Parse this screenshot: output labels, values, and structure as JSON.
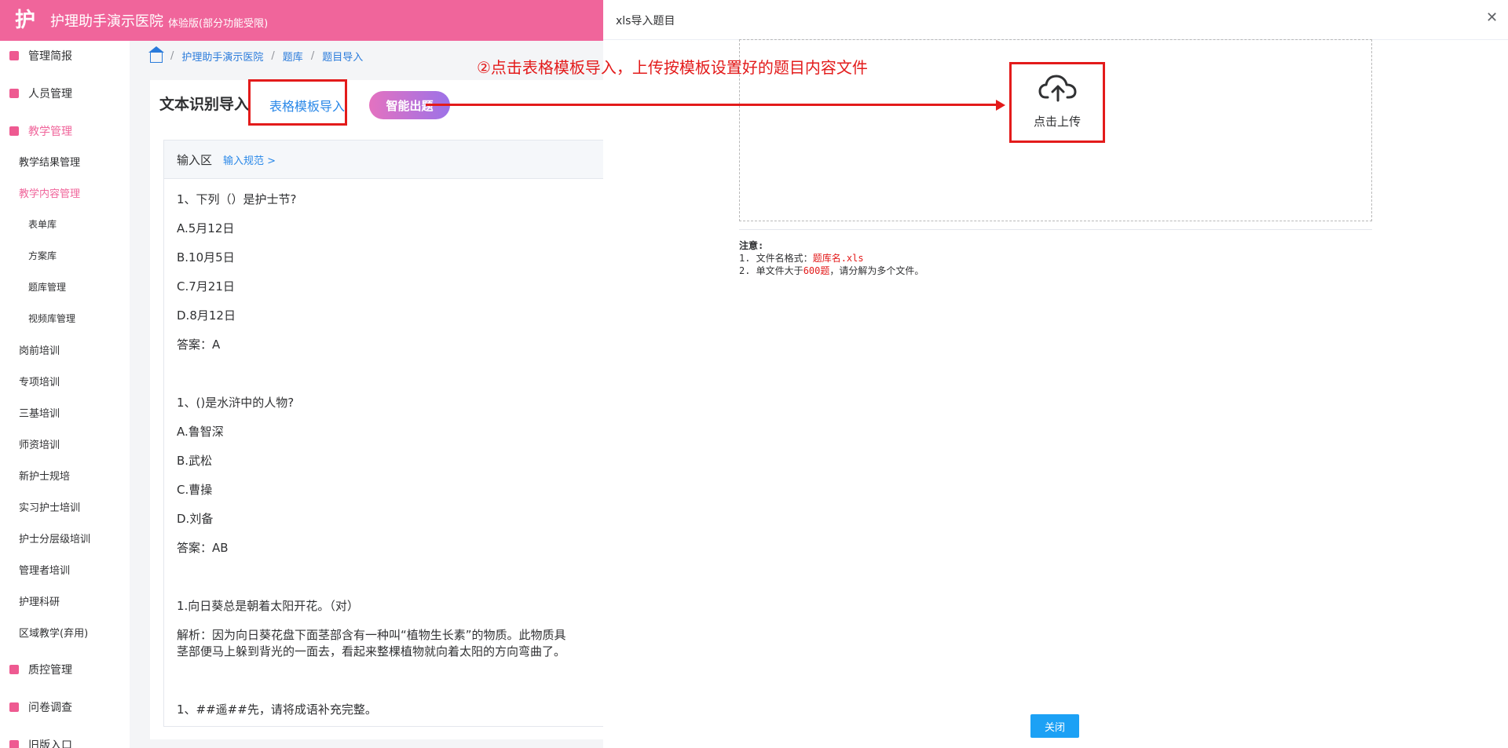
{
  "header": {
    "logo_text": "护",
    "title": "护理助手演示医院",
    "subtitle": "体验版(部分功能受限)"
  },
  "sidebar": {
    "items": [
      {
        "label": "管理简报"
      },
      {
        "label": "人员管理"
      },
      {
        "label": "教学管理"
      },
      {
        "label": "教学结果管理"
      },
      {
        "label": "教学内容管理"
      },
      {
        "label": "表单库"
      },
      {
        "label": "方案库"
      },
      {
        "label": "题库管理"
      },
      {
        "label": "视频库管理"
      },
      {
        "label": "岗前培训"
      },
      {
        "label": "专项培训"
      },
      {
        "label": "三基培训"
      },
      {
        "label": "师资培训"
      },
      {
        "label": "新护士规培"
      },
      {
        "label": "实习护士培训"
      },
      {
        "label": "护士分层级培训"
      },
      {
        "label": "管理者培训"
      },
      {
        "label": "护理科研"
      },
      {
        "label": "区域教学(弃用)"
      },
      {
        "label": "质控管理"
      },
      {
        "label": "问卷调查"
      },
      {
        "label": "旧版入口"
      }
    ]
  },
  "breadcrumb": {
    "items": [
      "护理助手演示医院",
      "题库",
      "题目导入"
    ],
    "separator": "/"
  },
  "main": {
    "title": "文本识别导入",
    "tab_template": "表格模板导入",
    "ai_button": "智能出题",
    "input_panel": {
      "header": "输入区",
      "spec_link": "输入规范 >",
      "lines": [
        "1、下列（）是护士节?",
        "A.5月12日",
        "B.10月5日",
        "C.7月21日",
        "D.8月12日",
        "答案：A",
        "1、()是水浒中的人物?",
        "A.鲁智深",
        "B.武松",
        "C.曹操",
        "D.刘备",
        "答案：AB",
        "1.向日葵总是朝着太阳开花。（对）",
        "解析：因为向日葵花盘下面茎部含有一种叫“植物生长素”的物质。此物质具",
        "茎部便马上躲到背光的一面去，看起来整棵植物就向着太阳的方向弯曲了。",
        "1、##遥##先，请将成语补充完整。"
      ]
    }
  },
  "annotation": {
    "text": "②点击表格模板导入，上传按模板设置好的题目内容文件",
    "color": "#e31b1b"
  },
  "drawer": {
    "title": "xls导入题目",
    "upload_text": "点击上传",
    "note_title": "注意:",
    "note1_prefix": "1. 文件名格式：",
    "note1_value": "题库名.xls",
    "note2_prefix": "2. 单文件大于",
    "note2_value": "600题",
    "note2_suffix": "，请分解为多个文件。",
    "close_button": "关闭"
  },
  "colors": {
    "brand": "#f0659b",
    "link": "#2a88e8",
    "primary_button": "#1ca1f5"
  }
}
